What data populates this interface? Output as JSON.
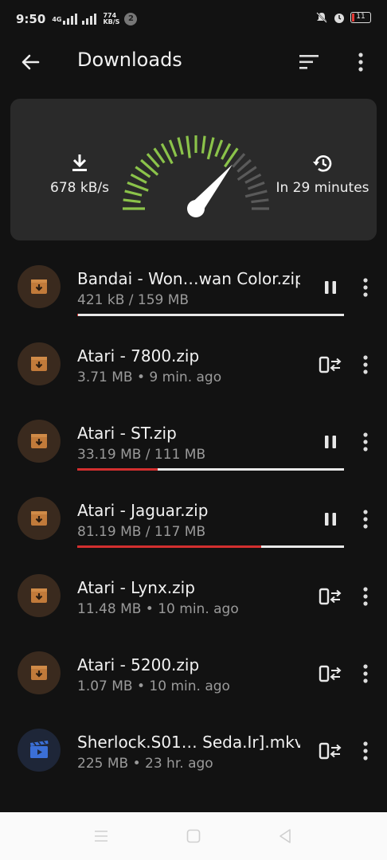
{
  "status_bar": {
    "time": "9:50",
    "network": "4G",
    "speed_value": "774",
    "speed_unit": "KB/S",
    "notification_count": "2",
    "battery": "11"
  },
  "app_bar": {
    "title": "Downloads",
    "icons": [
      "back-arrow-icon",
      "sort-icon",
      "more-vert-icon"
    ]
  },
  "stats": {
    "speed": "678 kB/s",
    "eta": "In 29 minutes",
    "gauge_level": 0.72,
    "colors": {
      "active_tick": "#8bc34a",
      "inactive_tick": "#5a5a5a"
    }
  },
  "downloads": [
    {
      "name": "Bandai - Won…wan Color.zip",
      "meta": "421 kB / 159 MB",
      "type": "archive",
      "state": "downloading",
      "progress": 0.003
    },
    {
      "name": "Atari - 7800.zip",
      "meta": "3.71 MB • 9 min. ago",
      "type": "archive",
      "state": "done"
    },
    {
      "name": "Atari - ST.zip",
      "meta": "33.19 MB / 111 MB",
      "type": "archive",
      "state": "downloading",
      "progress": 0.3
    },
    {
      "name": "Atari - Jaguar.zip",
      "meta": "81.19 MB / 117 MB",
      "type": "archive",
      "state": "downloading",
      "progress": 0.69
    },
    {
      "name": "Atari - Lynx.zip",
      "meta": "11.48 MB • 10 min. ago",
      "type": "archive",
      "state": "done"
    },
    {
      "name": "Atari - 5200.zip",
      "meta": "1.07 MB • 10 min. ago",
      "type": "archive",
      "state": "done"
    },
    {
      "name": "Sherlock.S01… Seda.Ir].mkv",
      "meta": "225 MB • 23 hr. ago",
      "type": "video",
      "state": "done"
    }
  ],
  "colors": {
    "background": "#121212",
    "card": "#2a2a2a",
    "progress": "#d32f2f",
    "archive_icon": "#c17a3a",
    "video_icon": "#3b6fd6"
  }
}
